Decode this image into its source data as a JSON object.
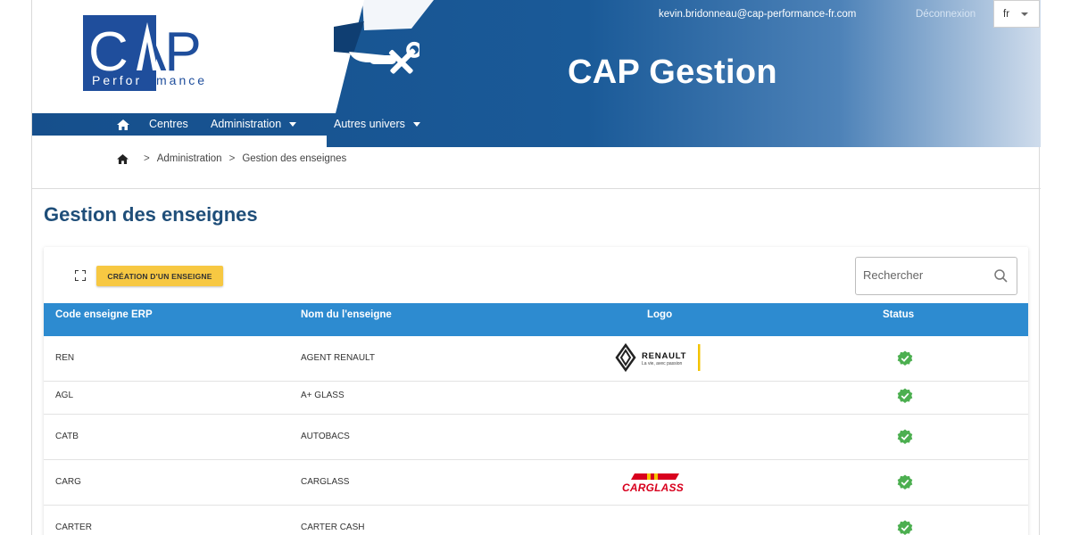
{
  "header": {
    "logo_letters": "CAP",
    "logo_sub": "Performance",
    "title": "CAP Gestion",
    "user_email": "kevin.bridonneau@cap-performance-fr.com",
    "logout_label": "Déconnexion",
    "language": "fr",
    "colors": {
      "primary": "#1f5c99",
      "dark": "#174f8c",
      "accent": "#2d8bd0"
    }
  },
  "nav": {
    "items": [
      {
        "label": "Centres",
        "has_dropdown": false
      },
      {
        "label": "Administration",
        "has_dropdown": true
      },
      {
        "label": "Autres univers",
        "has_dropdown": true
      }
    ]
  },
  "breadcrumb": {
    "separator": ">",
    "items": [
      "Administration",
      "Gestion des enseignes"
    ]
  },
  "page": {
    "title": "Gestion des enseignes",
    "create_button_label": "CRÉATION D'UN ENSEIGNE",
    "search_placeholder": "Rechercher"
  },
  "table": {
    "columns": [
      "Code enseigne ERP",
      "Nom du l'enseigne",
      "Logo",
      "Status"
    ],
    "rows": [
      {
        "code": "REN",
        "name": "AGENT RENAULT",
        "logo": "renault-logo",
        "logo_brand": "RENAULT",
        "logo_tagline": "La vie, avec passion",
        "status": "active"
      },
      {
        "code": "AGL",
        "name": "A+ GLASS",
        "logo": "",
        "status": "active"
      },
      {
        "code": "CATB",
        "name": "AUTOBACS",
        "logo": "",
        "status": "active"
      },
      {
        "code": "CARG",
        "name": "CARGLASS",
        "logo": "carglass-logo",
        "logo_brand": "CARGLASS",
        "status": "active"
      },
      {
        "code": "CARTER",
        "name": "CARTER CASH",
        "logo": "",
        "status": "active"
      }
    ],
    "status_color": "#4caf50"
  }
}
